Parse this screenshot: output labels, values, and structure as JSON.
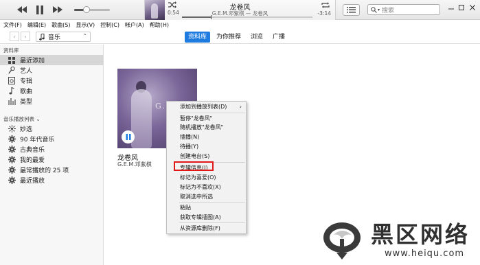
{
  "player": {
    "now_playing_title": "龙卷风",
    "now_playing_subtitle": "G.E.M.邓紫棋 — 龙卷风",
    "elapsed": "0:54",
    "remaining": "-3:14",
    "progress": 0.22,
    "volume": 0.34,
    "search_placeholder": "搜索"
  },
  "menubar": [
    "文件(F)",
    "编辑(E)",
    "歌曲(S)",
    "显示(V)",
    "控制(C)",
    "帐户(A)",
    "帮助(H)"
  ],
  "nav": {
    "media_select": "音乐",
    "tabs": [
      {
        "label": "资料库",
        "active": true
      },
      {
        "label": "为你推荐",
        "active": false
      },
      {
        "label": "浏览",
        "active": false
      },
      {
        "label": "广播",
        "active": false
      }
    ]
  },
  "sidebar": {
    "library_header": "资料库",
    "library_items": [
      {
        "label": "最近添加",
        "icon": "recent-grid-icon",
        "selected": true
      },
      {
        "label": "艺人",
        "icon": "microphone-icon",
        "selected": false
      },
      {
        "label": "专辑",
        "icon": "album-icon",
        "selected": false
      },
      {
        "label": "歌曲",
        "icon": "music-note-icon",
        "selected": false
      },
      {
        "label": "类型",
        "icon": "genre-icon",
        "selected": false
      }
    ],
    "playlists_header": "音乐播放列表 ⌄",
    "playlist_items": [
      {
        "label": "妙选",
        "icon": "genius-icon"
      },
      {
        "label": "90 年代音乐",
        "icon": "gear-icon"
      },
      {
        "label": "古典音乐",
        "icon": "gear-icon"
      },
      {
        "label": "我的最爱",
        "icon": "gear-icon"
      },
      {
        "label": "最常播放的 25 项",
        "icon": "gear-icon"
      },
      {
        "label": "最近播放",
        "icon": "gear-icon"
      }
    ]
  },
  "album": {
    "title": "龙卷风",
    "artist": "G.E.M.邓紫棋",
    "art_text": "G.E.M."
  },
  "context_menu": {
    "items": [
      {
        "label": "添加到播放列表(D)",
        "submenu": true
      },
      {
        "label": "暂停\"龙卷风\""
      },
      {
        "label": "随机播放\"龙卷风\""
      },
      {
        "label": "插播(N)"
      },
      {
        "label": "待播(Y)"
      },
      {
        "label": "创建电台(S)"
      },
      {
        "label": "专辑信息(I)",
        "highlighted": true
      },
      {
        "label": "标记为喜爱(O)"
      },
      {
        "label": "标记为不喜欢(X)"
      },
      {
        "label": "取消选中所选"
      },
      {
        "label": "粘贴"
      },
      {
        "label": "获取专辑插图(A)"
      },
      {
        "label": "从资源库删除(F)"
      }
    ],
    "submenu_arrow": "›"
  },
  "watermark": {
    "title": "黑区网络",
    "domain": "www.heiqu.com"
  },
  "colors": {
    "accent": "#1e7ce0",
    "highlight_box": "#e01818",
    "sidebar_bg": "#f7f7f7",
    "menu_bg": "#f2f2f2"
  }
}
